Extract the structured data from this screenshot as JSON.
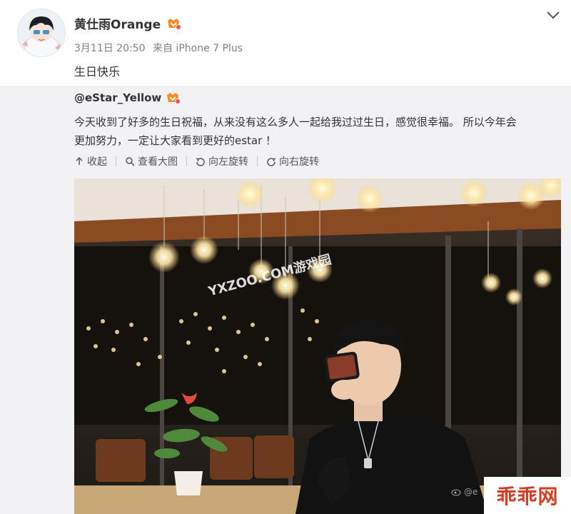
{
  "post": {
    "author": "黄仕雨Orange",
    "time": "3月11日 20:50",
    "source": "来自 iPhone 7 Plus",
    "text": "生日快乐"
  },
  "repost": {
    "author": "@eStar_Yellow",
    "text_line1": "今天收到了好多的生日祝福，从来没有这么多人一起给我过过生日，感觉很幸福。 所以今年会",
    "text_line2": "更加努力，一定让大家看到更好的estar ！",
    "actions": {
      "collapse": "收起",
      "view_large": "查看大图",
      "rotate_left": "向左旋转",
      "rotate_right": "向右旋转"
    }
  },
  "watermarks": {
    "photo": "YXZOO.COM游戏园",
    "weibo": "@e",
    "site_logo": "乖乖网"
  },
  "colors": {
    "repost_bg": "#f2f2f5",
    "logo_red": "#d73b24",
    "meta_gray": "#808080"
  }
}
